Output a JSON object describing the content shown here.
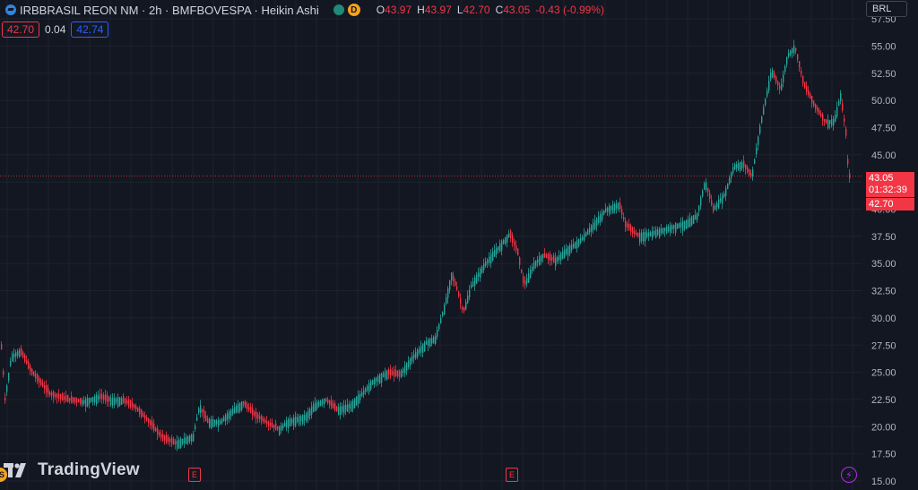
{
  "header": {
    "symbol": "IRBBRASIL REON NM · 2h · BMFBOVESPA · Heikin Ashi",
    "status_badge": "D",
    "ohlc": [
      {
        "k": "O",
        "v": "43.97"
      },
      {
        "k": "H",
        "v": "43.97"
      },
      {
        "k": "L",
        "v": "42.70"
      },
      {
        "k": "C",
        "v": "43.05"
      }
    ],
    "change": "-0.43 (-0.99%)"
  },
  "indicators": {
    "bid": "42.70",
    "spread": "0.04",
    "ask": "42.74"
  },
  "currency": "BRL",
  "price_tags": {
    "last": "43.05",
    "countdown": "01:32:39",
    "low": "42.70"
  },
  "brand": {
    "name": "TradingView"
  },
  "events": {
    "earnings": "E",
    "split": "S",
    "flash": "⚡"
  },
  "colors": {
    "up": "#26a69a",
    "down": "#f23645",
    "background": "#131722",
    "grid": "#1e222d",
    "text": "#b2b5be"
  },
  "chart_data": {
    "type": "candlestick",
    "style": "Heikin Ashi",
    "ylim": [
      15,
      57.5
    ],
    "y_ticks": [
      "15.00",
      "17.50",
      "20.00",
      "22.50",
      "25.00",
      "27.50",
      "30.00",
      "32.50",
      "35.00",
      "37.50",
      "40.00",
      "42.50",
      "45.00",
      "47.50",
      "50.00",
      "52.50",
      "55.00",
      "57.50"
    ],
    "current_price": 43.05,
    "grid": true,
    "trend_points": [
      [
        0,
        28.5
      ],
      [
        5,
        22.5
      ],
      [
        12,
        26.5
      ],
      [
        22,
        27.0
      ],
      [
        35,
        25.0
      ],
      [
        55,
        23.0
      ],
      [
        75,
        22.5
      ],
      [
        90,
        22.3
      ],
      [
        110,
        22.8
      ],
      [
        120,
        22.5
      ],
      [
        135,
        22.5
      ],
      [
        150,
        21.8
      ],
      [
        165,
        20.5
      ],
      [
        180,
        19.0
      ],
      [
        195,
        18.5
      ],
      [
        215,
        19.2
      ],
      [
        222,
        22.0
      ],
      [
        230,
        20.5
      ],
      [
        245,
        20.5
      ],
      [
        258,
        21.5
      ],
      [
        270,
        22.2
      ],
      [
        285,
        21.0
      ],
      [
        300,
        20.2
      ],
      [
        310,
        19.8
      ],
      [
        320,
        20.5
      ],
      [
        340,
        21.0
      ],
      [
        350,
        22.0
      ],
      [
        362,
        22.5
      ],
      [
        375,
        21.6
      ],
      [
        390,
        22.0
      ],
      [
        402,
        23.0
      ],
      [
        415,
        24.2
      ],
      [
        430,
        25.0
      ],
      [
        445,
        24.8
      ],
      [
        460,
        26.5
      ],
      [
        475,
        27.8
      ],
      [
        485,
        28.2
      ],
      [
        495,
        31.0
      ],
      [
        503,
        34.0
      ],
      [
        510,
        32.5
      ],
      [
        516,
        30.5
      ],
      [
        525,
        33.0
      ],
      [
        540,
        35.0
      ],
      [
        555,
        36.5
      ],
      [
        568,
        37.8
      ],
      [
        577,
        36.0
      ],
      [
        584,
        33.0
      ],
      [
        595,
        35.0
      ],
      [
        605,
        35.8
      ],
      [
        618,
        35.3
      ],
      [
        630,
        36.2
      ],
      [
        648,
        37.3
      ],
      [
        660,
        38.5
      ],
      [
        675,
        40.0
      ],
      [
        690,
        40.5
      ],
      [
        697,
        38.6
      ],
      [
        710,
        37.6
      ],
      [
        725,
        37.8
      ],
      [
        740,
        38.2
      ],
      [
        752,
        38.5
      ],
      [
        765,
        38.8
      ],
      [
        777,
        39.5
      ],
      [
        786,
        42.6
      ],
      [
        795,
        40.0
      ],
      [
        808,
        41.5
      ],
      [
        818,
        44.0
      ],
      [
        828,
        44.2
      ],
      [
        838,
        43.0
      ],
      [
        848,
        48.0
      ],
      [
        860,
        52.8
      ],
      [
        870,
        51.0
      ],
      [
        878,
        54.2
      ],
      [
        886,
        55.0
      ],
      [
        896,
        51.5
      ],
      [
        908,
        49.5
      ],
      [
        920,
        48.0
      ],
      [
        930,
        48.2
      ],
      [
        937,
        50.5
      ],
      [
        943,
        47.0
      ],
      [
        946,
        43.0
      ],
      [
        949,
        43.0
      ]
    ]
  }
}
